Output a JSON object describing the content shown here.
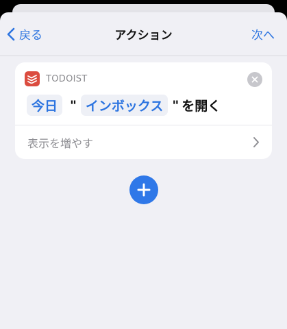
{
  "navbar": {
    "back_label": "戻る",
    "title": "アクション",
    "next_label": "次へ"
  },
  "action": {
    "app_name": "TODOIST",
    "app_icon": "todoist-icon",
    "param_1": "今日",
    "quote_open": "\"",
    "param_2": "インボックス",
    "quote_close": "\"",
    "verb": "を開く",
    "show_more": "表示を増やす"
  },
  "colors": {
    "accent": "#2c74e0",
    "todoist_red": "#db4c3f",
    "background": "#f0f0f5"
  }
}
